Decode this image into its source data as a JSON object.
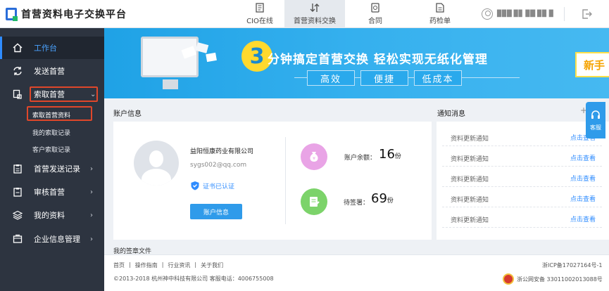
{
  "header": {
    "app_title": "首营资料电子交换平台",
    "nav": [
      {
        "label": "CIO在线",
        "icon": "document-icon"
      },
      {
        "label": "首营资料交换",
        "icon": "exchange-icon"
      },
      {
        "label": "合同",
        "icon": "contract-icon"
      },
      {
        "label": "药检单",
        "icon": "report-icon"
      }
    ],
    "user_name": "▉▉█ ▉▊ ▉█ ▉▉ ▉"
  },
  "sidebar": {
    "items": [
      {
        "label": "工作台",
        "icon": "home-icon"
      },
      {
        "label": "发送首营",
        "icon": "sync-icon"
      },
      {
        "label": "索取首营",
        "icon": "request-icon"
      },
      {
        "label": "首营发送记录",
        "icon": "clipboard-icon"
      },
      {
        "label": "审核首营",
        "icon": "audit-icon"
      },
      {
        "label": "我的资料",
        "icon": "layers-icon"
      },
      {
        "label": "企业信息管理",
        "icon": "building-icon"
      }
    ],
    "sub_items": [
      "索取首营资料",
      "我的索取记录",
      "客户索取记录"
    ]
  },
  "banner": {
    "number": "3",
    "title": "分钟搞定首营交换   轻松实现无纸化管理",
    "tags": [
      "高效",
      "便捷",
      "低成本"
    ],
    "new_button": "新手"
  },
  "account": {
    "section_title": "账户信息",
    "company": "益阳恒康药业有限公司",
    "email": "sygs002@qq.com",
    "cert_status": "证书已认证",
    "button_label": "账户信息",
    "balance_label": "账户余额：",
    "balance": "16",
    "balance_unit": "份",
    "pending_label": "待签署：",
    "pending": "69",
    "pending_unit": "份"
  },
  "notices": {
    "section_title": "通知消息",
    "more": "+",
    "items": [
      {
        "text": "资料更新通知",
        "link": "点击查看"
      },
      {
        "text": "资料更新通知",
        "link": "点击查看"
      },
      {
        "text": "资料更新通知",
        "link": "点击查看"
      },
      {
        "text": "资料更新通知",
        "link": "点击查看"
      },
      {
        "text": "资料更新通知",
        "link": "点击查看"
      }
    ]
  },
  "help": {
    "label": "客服"
  },
  "next_section": "我的签章文件",
  "footer": {
    "links": [
      "首页",
      "|",
      "操作指南",
      "|",
      "行业资讯",
      "|",
      "关于我们"
    ],
    "copyright": "©2013-2018  杭州神中科技有限公司  客服电话：4006755008",
    "icp": "浙ICP备17027164号-1",
    "police": "浙公网安备 33011002013088号"
  },
  "colors": {
    "accent": "#2f8cff",
    "sidebar": "#2d3440",
    "highlight": "#e0472a",
    "banner": "#1fa2e6"
  }
}
